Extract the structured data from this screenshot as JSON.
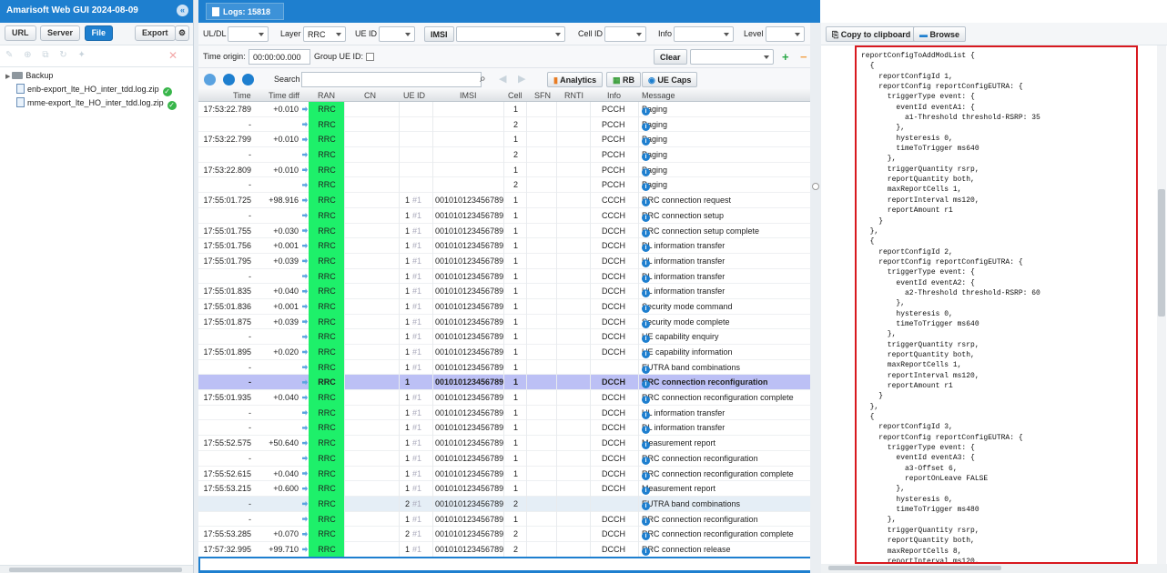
{
  "app": {
    "title": "Amarisoft Web GUI 2024-08-09"
  },
  "left_toolbar": {
    "url": "URL",
    "server": "Server",
    "file": "File",
    "export": "Export"
  },
  "tree": {
    "folder": "Backup",
    "files": [
      "enb-export_lte_HO_inter_tdd.log.zip",
      "mme-export_lte_HO_inter_tdd.log.zip"
    ]
  },
  "tab": {
    "label": "Logs: 15818"
  },
  "filters": {
    "uldl_label": "UL/DL",
    "layer_label": "Layer",
    "layer_value": "RRC",
    "ueid_label": "UE ID",
    "imsi_btn": "IMSI",
    "cellid_label": "Cell ID",
    "info_label": "Info",
    "level_label": "Level",
    "time_origin_label": "Time origin:",
    "time_origin_value": "00:00:00.000",
    "group_ueid_label": "Group UE ID:",
    "clear": "Clear"
  },
  "search": {
    "label": "Search",
    "analytics": "Analytics",
    "rb": "RB",
    "uecaps": "UE Caps"
  },
  "columns": [
    "Time",
    "Time diff",
    "RAN",
    "CN",
    "UE ID",
    "IMSI",
    "Cell",
    "SFN",
    "RNTI",
    "Info",
    "Message"
  ],
  "rows": [
    {
      "time": "17:53:22.789",
      "diff": "+0.010",
      "ran": "RRC",
      "ue": "",
      "hash": "",
      "imsi": "",
      "cell": "1",
      "info": "PCCH",
      "msg": "Paging",
      "style": ""
    },
    {
      "time": "-",
      "diff": "",
      "ran": "RRC",
      "ue": "",
      "hash": "",
      "imsi": "",
      "cell": "2",
      "info": "PCCH",
      "msg": "Paging",
      "style": ""
    },
    {
      "time": "17:53:22.799",
      "diff": "+0.010",
      "ran": "RRC",
      "ue": "",
      "hash": "",
      "imsi": "",
      "cell": "1",
      "info": "PCCH",
      "msg": "Paging",
      "style": ""
    },
    {
      "time": "-",
      "diff": "",
      "ran": "RRC",
      "ue": "",
      "hash": "",
      "imsi": "",
      "cell": "2",
      "info": "PCCH",
      "msg": "Paging",
      "style": ""
    },
    {
      "time": "17:53:22.809",
      "diff": "+0.010",
      "ran": "RRC",
      "ue": "",
      "hash": "",
      "imsi": "",
      "cell": "1",
      "info": "PCCH",
      "msg": "Paging",
      "style": ""
    },
    {
      "time": "-",
      "diff": "",
      "ran": "RRC",
      "ue": "",
      "hash": "",
      "imsi": "",
      "cell": "2",
      "info": "PCCH",
      "msg": "Paging",
      "style": ""
    },
    {
      "time": "17:55:01.725",
      "diff": "+98.916",
      "ran": "RRC",
      "ue": "1",
      "hash": "#1",
      "imsi": "001010123456789",
      "cell": "1",
      "info": "CCCH",
      "msg": "RRC connection request",
      "style": ""
    },
    {
      "time": "-",
      "diff": "",
      "ran": "RRC",
      "ue": "1",
      "hash": "#1",
      "imsi": "001010123456789",
      "cell": "1",
      "info": "CCCH",
      "msg": "RRC connection setup",
      "style": ""
    },
    {
      "time": "17:55:01.755",
      "diff": "+0.030",
      "ran": "RRC",
      "ue": "1",
      "hash": "#1",
      "imsi": "001010123456789",
      "cell": "1",
      "info": "DCCH",
      "msg": "RRC connection setup complete",
      "style": ""
    },
    {
      "time": "17:55:01.756",
      "diff": "+0.001",
      "ran": "RRC",
      "ue": "1",
      "hash": "#1",
      "imsi": "001010123456789",
      "cell": "1",
      "info": "DCCH",
      "msg": "DL information transfer",
      "style": ""
    },
    {
      "time": "17:55:01.795",
      "diff": "+0.039",
      "ran": "RRC",
      "ue": "1",
      "hash": "#1",
      "imsi": "001010123456789",
      "cell": "1",
      "info": "DCCH",
      "msg": "UL information transfer",
      "style": ""
    },
    {
      "time": "-",
      "diff": "",
      "ran": "RRC",
      "ue": "1",
      "hash": "#1",
      "imsi": "001010123456789",
      "cell": "1",
      "info": "DCCH",
      "msg": "DL information transfer",
      "style": ""
    },
    {
      "time": "17:55:01.835",
      "diff": "+0.040",
      "ran": "RRC",
      "ue": "1",
      "hash": "#1",
      "imsi": "001010123456789",
      "cell": "1",
      "info": "DCCH",
      "msg": "UL information transfer",
      "style": ""
    },
    {
      "time": "17:55:01.836",
      "diff": "+0.001",
      "ran": "RRC",
      "ue": "1",
      "hash": "#1",
      "imsi": "001010123456789",
      "cell": "1",
      "info": "DCCH",
      "msg": "Security mode command",
      "style": ""
    },
    {
      "time": "17:55:01.875",
      "diff": "+0.039",
      "ran": "RRC",
      "ue": "1",
      "hash": "#1",
      "imsi": "001010123456789",
      "cell": "1",
      "info": "DCCH",
      "msg": "Security mode complete",
      "style": ""
    },
    {
      "time": "-",
      "diff": "",
      "ran": "RRC",
      "ue": "1",
      "hash": "#1",
      "imsi": "001010123456789",
      "cell": "1",
      "info": "DCCH",
      "msg": "UE capability enquiry",
      "style": ""
    },
    {
      "time": "17:55:01.895",
      "diff": "+0.020",
      "ran": "RRC",
      "ue": "1",
      "hash": "#1",
      "imsi": "001010123456789",
      "cell": "1",
      "info": "DCCH",
      "msg": "UE capability information",
      "style": ""
    },
    {
      "time": "-",
      "diff": "",
      "ran": "RRC",
      "ue": "1",
      "hash": "#1",
      "imsi": "001010123456789",
      "cell": "1",
      "info": "",
      "msg": "EUTRA band combinations",
      "style": ""
    },
    {
      "time": "-",
      "diff": "",
      "ran": "RRC",
      "ue": "1",
      "hash": "",
      "imsi": "001010123456789",
      "cell": "1",
      "info": "DCCH",
      "msg": "RRC connection reconfiguration",
      "style": "selr"
    },
    {
      "time": "17:55:01.935",
      "diff": "+0.040",
      "ran": "RRC",
      "ue": "1",
      "hash": "#1",
      "imsi": "001010123456789",
      "cell": "1",
      "info": "DCCH",
      "msg": "RRC connection reconfiguration complete",
      "style": ""
    },
    {
      "time": "-",
      "diff": "",
      "ran": "RRC",
      "ue": "1",
      "hash": "#1",
      "imsi": "001010123456789",
      "cell": "1",
      "info": "DCCH",
      "msg": "UL information transfer",
      "style": ""
    },
    {
      "time": "-",
      "diff": "",
      "ran": "RRC",
      "ue": "1",
      "hash": "#1",
      "imsi": "001010123456789",
      "cell": "1",
      "info": "DCCH",
      "msg": "DL information transfer",
      "style": ""
    },
    {
      "time": "17:55:52.575",
      "diff": "+50.640",
      "ran": "RRC",
      "ue": "1",
      "hash": "#1",
      "imsi": "001010123456789",
      "cell": "1",
      "info": "DCCH",
      "msg": "Measurement report",
      "style": ""
    },
    {
      "time": "-",
      "diff": "",
      "ran": "RRC",
      "ue": "1",
      "hash": "#1",
      "imsi": "001010123456789",
      "cell": "1",
      "info": "DCCH",
      "msg": "RRC connection reconfiguration",
      "style": ""
    },
    {
      "time": "17:55:52.615",
      "diff": "+0.040",
      "ran": "RRC",
      "ue": "1",
      "hash": "#1",
      "imsi": "001010123456789",
      "cell": "1",
      "info": "DCCH",
      "msg": "RRC connection reconfiguration complete",
      "style": ""
    },
    {
      "time": "17:55:53.215",
      "diff": "+0.600",
      "ran": "RRC",
      "ue": "1",
      "hash": "#1",
      "imsi": "001010123456789",
      "cell": "1",
      "info": "DCCH",
      "msg": "Measurement report",
      "style": ""
    },
    {
      "time": "-",
      "diff": "",
      "ran": "RRC",
      "ue": "2",
      "hash": "#1",
      "imsi": "001010123456789",
      "cell": "2",
      "info": "",
      "msg": "EUTRA band combinations",
      "style": "alt"
    },
    {
      "time": "-",
      "diff": "",
      "ran": "RRC",
      "ue": "1",
      "hash": "#1",
      "imsi": "001010123456789",
      "cell": "1",
      "info": "DCCH",
      "msg": "RRC connection reconfiguration",
      "style": ""
    },
    {
      "time": "17:55:53.285",
      "diff": "+0.070",
      "ran": "RRC",
      "ue": "2",
      "hash": "#1",
      "imsi": "001010123456789",
      "cell": "2",
      "info": "DCCH",
      "msg": "RRC connection reconfiguration complete",
      "style": ""
    },
    {
      "time": "17:57:32.995",
      "diff": "+99.710",
      "ran": "RRC",
      "ue": "1",
      "hash": "#1",
      "imsi": "001010123456789",
      "cell": "2",
      "info": "DCCH",
      "msg": "RRC connection release",
      "style": ""
    }
  ],
  "right_toolbar": {
    "copy": "Copy to clipboard",
    "browse": "Browse"
  },
  "code_lines": [
    "reportConfigToAddModList {",
    "  {",
    "    reportConfigId 1,",
    "    reportConfig reportConfigEUTRA: {",
    "      triggerType event: {",
    "        eventId eventA1: {",
    "          a1-Threshold threshold-RSRP: 35",
    "        },",
    "        hysteresis 0,",
    "        timeToTrigger ms640",
    "      },",
    "      triggerQuantity rsrp,",
    "      reportQuantity both,",
    "      maxReportCells 1,",
    "      reportInterval ms120,",
    "      reportAmount r1",
    "    }",
    "  },",
    "  {",
    "    reportConfigId 2,",
    "    reportConfig reportConfigEUTRA: {",
    "      triggerType event: {",
    "        eventId eventA2: {",
    "          a2-Threshold threshold-RSRP: 60",
    "        },",
    "        hysteresis 0,",
    "        timeToTrigger ms640",
    "      },",
    "      triggerQuantity rsrp,",
    "      reportQuantity both,",
    "      maxReportCells 1,",
    "      reportInterval ms120,",
    "      reportAmount r1",
    "    }",
    "  },",
    "  {",
    "    reportConfigId 3,",
    "    reportConfig reportConfigEUTRA: {",
    "      triggerType event: {",
    "        eventId eventA3: {",
    "          a3-Offset 6,",
    "          reportOnLeave FALSE",
    "        },",
    "        hysteresis 0,",
    "        timeToTrigger ms480",
    "      },",
    "      triggerQuantity rsrp,",
    "      reportQuantity both,",
    "      maxReportCells 8,",
    "      reportInterval ms120,"
  ]
}
